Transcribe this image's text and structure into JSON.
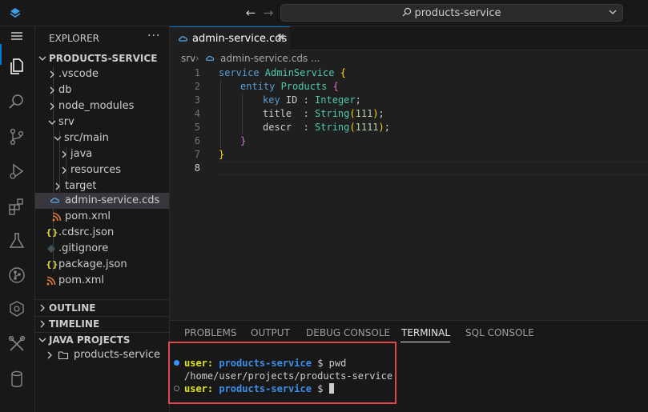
{
  "titlebar": {
    "search_text": "products-service"
  },
  "sidebar": {
    "title": "EXPLORER",
    "more": "···",
    "root": "PRODUCTS-SERVICE",
    "tree": [
      {
        "label": ".vscode",
        "type": "folder",
        "open": false
      },
      {
        "label": "db",
        "type": "folder",
        "open": false
      },
      {
        "label": "node_modules",
        "type": "folder",
        "open": false
      },
      {
        "label": "srv",
        "type": "folder",
        "open": true
      },
      {
        "label": "src/main",
        "type": "folder",
        "open": true
      },
      {
        "label": "java",
        "type": "folder",
        "open": false
      },
      {
        "label": "resources",
        "type": "folder",
        "open": false
      },
      {
        "label": "target",
        "type": "folder",
        "open": false
      },
      {
        "label": "admin-service.cds",
        "type": "cds",
        "selected": true
      },
      {
        "label": "pom.xml",
        "type": "xml"
      },
      {
        "label": ".cdsrc.json",
        "type": "json"
      },
      {
        "label": ".gitignore",
        "type": "git"
      },
      {
        "label": "package.json",
        "type": "json"
      },
      {
        "label": "pom.xml",
        "type": "xml"
      }
    ],
    "sections": {
      "outline": "OUTLINE",
      "timeline": "TIMELINE",
      "java_projects": "JAVA PROJECTS",
      "java_project_item": "products-service"
    }
  },
  "editor": {
    "tab_label": "admin-service.cds",
    "tab_close": "✕",
    "breadcrumb": {
      "folder": "srv",
      "file": "admin-service.cds",
      "more": "..."
    },
    "line_numbers": [
      "1",
      "2",
      "3",
      "4",
      "5",
      "6",
      "7",
      "8"
    ],
    "code": {
      "l1_kw": "service",
      "l1_name": " AdminService ",
      "l1_brace": "{",
      "l2_kw": "entity",
      "l2_name": " Products ",
      "l2_brace": "{",
      "l3_kw": "key",
      "l3_field": " ID : ",
      "l3_type": "Integer",
      "l3_end": ";",
      "l4_field": "title  : ",
      "l4_type": "String",
      "l4_p1": "(",
      "l4_num": "111",
      "l4_p2": ")",
      "l4_end": ";",
      "l5_field": "descr  : ",
      "l5_type": "String",
      "l5_p1": "(",
      "l5_num": "1111",
      "l5_p2": ")",
      "l5_end": ";",
      "l6_brace": "}",
      "l7_brace": "}"
    }
  },
  "panel": {
    "tabs": [
      "PROBLEMS",
      "OUTPUT",
      "DEBUG CONSOLE",
      "TERMINAL",
      "SQL CONSOLE"
    ],
    "active_tab": "TERMINAL",
    "terminal": {
      "user": "user:",
      "dir": "products-service",
      "prompt": "$",
      "command": "pwd",
      "output": "/home/user/projects/products-service"
    }
  },
  "colors": {
    "accent": "#0078d4",
    "highlight_box": "#e0474c"
  }
}
